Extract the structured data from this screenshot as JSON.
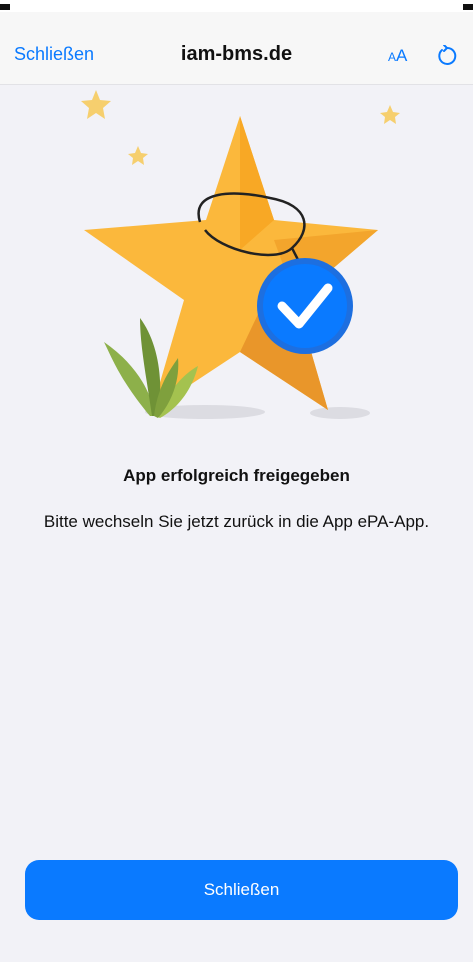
{
  "nav": {
    "close_label": "Schließen",
    "title": "iam-bms.de",
    "text_size_small": "A",
    "text_size_big": "A"
  },
  "content": {
    "heading": "App erfolgreich freigegeben",
    "message": "Bitte wechseln Sie jetzt zurück in die App ePA-App."
  },
  "footer": {
    "close_button_label": "Schließen"
  },
  "colors": {
    "accent": "#0a7aff",
    "star": "#fbb83c",
    "background": "#f2f2f7"
  },
  "icons": {
    "reload": "reload-icon",
    "illustration": "star-badge-checkmark"
  }
}
